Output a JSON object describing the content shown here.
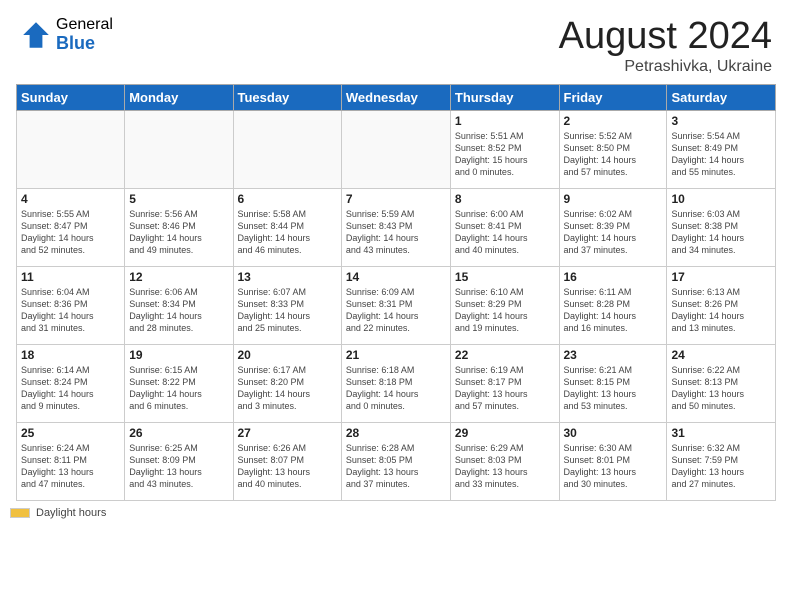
{
  "header": {
    "logo_general": "General",
    "logo_blue": "Blue",
    "month_year": "August 2024",
    "location": "Petrashivka, Ukraine"
  },
  "weekdays": [
    "Sunday",
    "Monday",
    "Tuesday",
    "Wednesday",
    "Thursday",
    "Friday",
    "Saturday"
  ],
  "weeks": [
    [
      {
        "day": "",
        "info": ""
      },
      {
        "day": "",
        "info": ""
      },
      {
        "day": "",
        "info": ""
      },
      {
        "day": "",
        "info": ""
      },
      {
        "day": "1",
        "info": "Sunrise: 5:51 AM\nSunset: 8:52 PM\nDaylight: 15 hours\nand 0 minutes."
      },
      {
        "day": "2",
        "info": "Sunrise: 5:52 AM\nSunset: 8:50 PM\nDaylight: 14 hours\nand 57 minutes."
      },
      {
        "day": "3",
        "info": "Sunrise: 5:54 AM\nSunset: 8:49 PM\nDaylight: 14 hours\nand 55 minutes."
      }
    ],
    [
      {
        "day": "4",
        "info": "Sunrise: 5:55 AM\nSunset: 8:47 PM\nDaylight: 14 hours\nand 52 minutes."
      },
      {
        "day": "5",
        "info": "Sunrise: 5:56 AM\nSunset: 8:46 PM\nDaylight: 14 hours\nand 49 minutes."
      },
      {
        "day": "6",
        "info": "Sunrise: 5:58 AM\nSunset: 8:44 PM\nDaylight: 14 hours\nand 46 minutes."
      },
      {
        "day": "7",
        "info": "Sunrise: 5:59 AM\nSunset: 8:43 PM\nDaylight: 14 hours\nand 43 minutes."
      },
      {
        "day": "8",
        "info": "Sunrise: 6:00 AM\nSunset: 8:41 PM\nDaylight: 14 hours\nand 40 minutes."
      },
      {
        "day": "9",
        "info": "Sunrise: 6:02 AM\nSunset: 8:39 PM\nDaylight: 14 hours\nand 37 minutes."
      },
      {
        "day": "10",
        "info": "Sunrise: 6:03 AM\nSunset: 8:38 PM\nDaylight: 14 hours\nand 34 minutes."
      }
    ],
    [
      {
        "day": "11",
        "info": "Sunrise: 6:04 AM\nSunset: 8:36 PM\nDaylight: 14 hours\nand 31 minutes."
      },
      {
        "day": "12",
        "info": "Sunrise: 6:06 AM\nSunset: 8:34 PM\nDaylight: 14 hours\nand 28 minutes."
      },
      {
        "day": "13",
        "info": "Sunrise: 6:07 AM\nSunset: 8:33 PM\nDaylight: 14 hours\nand 25 minutes."
      },
      {
        "day": "14",
        "info": "Sunrise: 6:09 AM\nSunset: 8:31 PM\nDaylight: 14 hours\nand 22 minutes."
      },
      {
        "day": "15",
        "info": "Sunrise: 6:10 AM\nSunset: 8:29 PM\nDaylight: 14 hours\nand 19 minutes."
      },
      {
        "day": "16",
        "info": "Sunrise: 6:11 AM\nSunset: 8:28 PM\nDaylight: 14 hours\nand 16 minutes."
      },
      {
        "day": "17",
        "info": "Sunrise: 6:13 AM\nSunset: 8:26 PM\nDaylight: 14 hours\nand 13 minutes."
      }
    ],
    [
      {
        "day": "18",
        "info": "Sunrise: 6:14 AM\nSunset: 8:24 PM\nDaylight: 14 hours\nand 9 minutes."
      },
      {
        "day": "19",
        "info": "Sunrise: 6:15 AM\nSunset: 8:22 PM\nDaylight: 14 hours\nand 6 minutes."
      },
      {
        "day": "20",
        "info": "Sunrise: 6:17 AM\nSunset: 8:20 PM\nDaylight: 14 hours\nand 3 minutes."
      },
      {
        "day": "21",
        "info": "Sunrise: 6:18 AM\nSunset: 8:18 PM\nDaylight: 14 hours\nand 0 minutes."
      },
      {
        "day": "22",
        "info": "Sunrise: 6:19 AM\nSunset: 8:17 PM\nDaylight: 13 hours\nand 57 minutes."
      },
      {
        "day": "23",
        "info": "Sunrise: 6:21 AM\nSunset: 8:15 PM\nDaylight: 13 hours\nand 53 minutes."
      },
      {
        "day": "24",
        "info": "Sunrise: 6:22 AM\nSunset: 8:13 PM\nDaylight: 13 hours\nand 50 minutes."
      }
    ],
    [
      {
        "day": "25",
        "info": "Sunrise: 6:24 AM\nSunset: 8:11 PM\nDaylight: 13 hours\nand 47 minutes."
      },
      {
        "day": "26",
        "info": "Sunrise: 6:25 AM\nSunset: 8:09 PM\nDaylight: 13 hours\nand 43 minutes."
      },
      {
        "day": "27",
        "info": "Sunrise: 6:26 AM\nSunset: 8:07 PM\nDaylight: 13 hours\nand 40 minutes."
      },
      {
        "day": "28",
        "info": "Sunrise: 6:28 AM\nSunset: 8:05 PM\nDaylight: 13 hours\nand 37 minutes."
      },
      {
        "day": "29",
        "info": "Sunrise: 6:29 AM\nSunset: 8:03 PM\nDaylight: 13 hours\nand 33 minutes."
      },
      {
        "day": "30",
        "info": "Sunrise: 6:30 AM\nSunset: 8:01 PM\nDaylight: 13 hours\nand 30 minutes."
      },
      {
        "day": "31",
        "info": "Sunrise: 6:32 AM\nSunset: 7:59 PM\nDaylight: 13 hours\nand 27 minutes."
      }
    ]
  ],
  "legend": {
    "bar_label": "Daylight hours"
  }
}
